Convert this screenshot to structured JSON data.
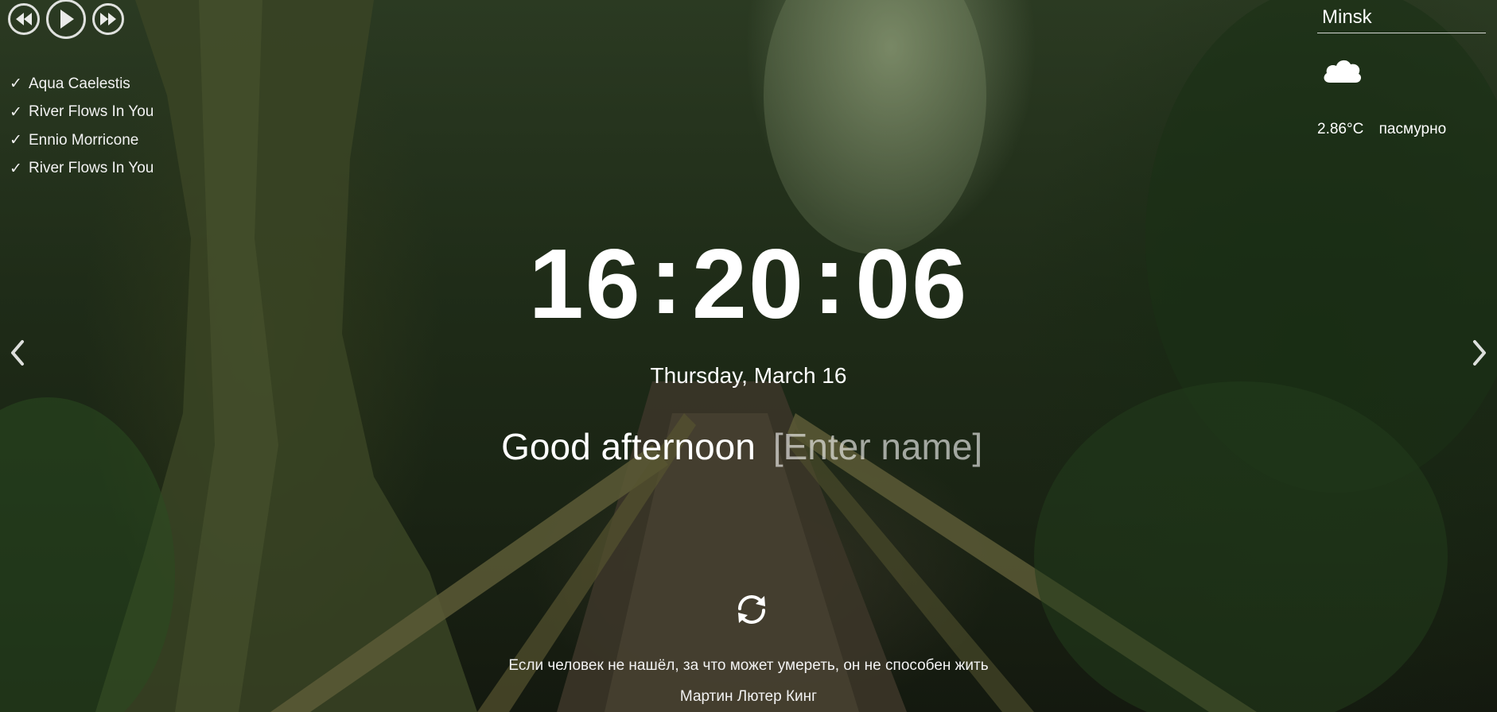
{
  "player": {
    "prev_icon": "rewind-icon",
    "play_icon": "play-icon",
    "next_icon": "fast-forward-icon",
    "playlist": [
      {
        "mark": "✓",
        "title": "Aqua Caelestis"
      },
      {
        "mark": "✓",
        "title": "River Flows In You"
      },
      {
        "mark": "✓",
        "title": "Ennio Morricone"
      },
      {
        "mark": "✓",
        "title": "River Flows In You"
      }
    ]
  },
  "weather": {
    "city": "Minsk",
    "icon": "cloud-icon",
    "temperature": "2.86°C",
    "description": "пасмурно"
  },
  "slider": {
    "prev_icon": "chevron-left-icon",
    "next_icon": "chevron-right-icon"
  },
  "clock": {
    "hours": "16",
    "minutes": "20",
    "seconds": "06",
    "separator": ":"
  },
  "date": "Thursday, March 16",
  "greeting": {
    "text": "Good afternoon",
    "name_placeholder": "[Enter name]"
  },
  "quote": {
    "refresh_icon": "refresh-icon",
    "text": "Если человек не нашёл, за что может умереть, он не способен жить",
    "author": "Мартин Лютер Кинг"
  },
  "colors": {
    "text": "#ffffff",
    "placeholder": "#bfbfbf",
    "background": "#1f2c18"
  }
}
